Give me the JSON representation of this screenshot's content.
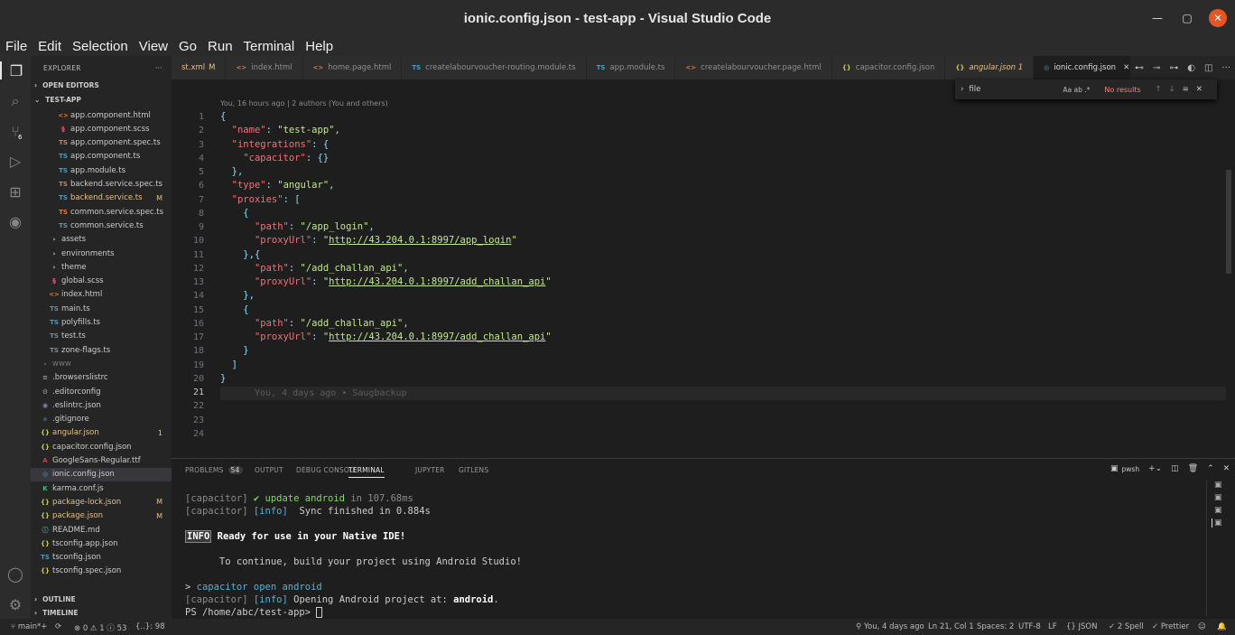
{
  "window": {
    "title": "ionic.config.json - test-app - Visual Studio Code"
  },
  "menu": [
    "File",
    "Edit",
    "Selection",
    "View",
    "Go",
    "Run",
    "Terminal",
    "Help"
  ],
  "activity_badge": "6",
  "explorer": {
    "header": "EXPLORER",
    "open_editors": "OPEN EDITORS",
    "project": "TEST-APP",
    "outline": "OUTLINE",
    "timeline": "TIMELINE",
    "files": [
      {
        "name": "app.component.html",
        "icon": "<>",
        "color": "#e37933",
        "indent": 1
      },
      {
        "name": "app.component.scss",
        "icon": "§",
        "color": "#f55385",
        "indent": 1
      },
      {
        "name": "app.component.spec.ts",
        "icon": "TS",
        "color": "#e37933",
        "indent": 1
      },
      {
        "name": "app.component.ts",
        "icon": "TS",
        "color": "#519aba",
        "indent": 1
      },
      {
        "name": "app.module.ts",
        "icon": "TS",
        "color": "#519aba",
        "indent": 1
      },
      {
        "name": "backend.service.spec.ts",
        "icon": "TS",
        "color": "#e37933",
        "indent": 1
      },
      {
        "name": "backend.service.ts",
        "icon": "TS",
        "color": "#519aba",
        "indent": 1,
        "status": "M",
        "modified": true
      },
      {
        "name": "common.service.spec.ts",
        "icon": "TS",
        "color": "#e37933",
        "indent": 1
      },
      {
        "name": "common.service.ts",
        "icon": "TS",
        "color": "#519aba",
        "indent": 1
      },
      {
        "name": "assets",
        "icon": "›",
        "color": "#ccc",
        "indent": 0.5
      },
      {
        "name": "environments",
        "icon": "›",
        "color": "#ccc",
        "indent": 0.5
      },
      {
        "name": "theme",
        "icon": "›",
        "color": "#ccc",
        "indent": 0.5
      },
      {
        "name": "global.scss",
        "icon": "§",
        "color": "#f55385",
        "indent": 0.5
      },
      {
        "name": "index.html",
        "icon": "<>",
        "color": "#e37933",
        "indent": 0.5
      },
      {
        "name": "main.ts",
        "icon": "TS",
        "color": "#519aba",
        "indent": 0.5
      },
      {
        "name": "polyfills.ts",
        "icon": "TS",
        "color": "#519aba",
        "indent": 0.5
      },
      {
        "name": "test.ts",
        "icon": "TS",
        "color": "#519aba",
        "indent": 0.5
      },
      {
        "name": "zone-flags.ts",
        "icon": "TS",
        "color": "#519aba",
        "indent": 0.5
      },
      {
        "name": "www",
        "icon": "›",
        "color": "#777",
        "indent": 0,
        "dim": true
      },
      {
        "name": ".browserslistrc",
        "icon": "≡",
        "color": "#999",
        "indent": 0
      },
      {
        "name": ".editorconfig",
        "icon": "⚙",
        "color": "#999",
        "indent": 0
      },
      {
        "name": ".eslintrc.json",
        "icon": "◉",
        "color": "#a074c4",
        "indent": 0
      },
      {
        "name": ".gitignore",
        "icon": "◆",
        "color": "#41535b",
        "indent": 0
      },
      {
        "name": "angular.json",
        "icon": "{}",
        "color": "#cbcb41",
        "indent": 0,
        "status": "1",
        "modified": true
      },
      {
        "name": "capacitor.config.json",
        "icon": "{}",
        "color": "#cbcb41",
        "indent": 0
      },
      {
        "name": "GoogleSans-Regular.ttf",
        "icon": "A",
        "color": "#cc3e44",
        "indent": 0
      },
      {
        "name": "ionic.config.json",
        "icon": "◎",
        "color": "#519aba",
        "indent": 0,
        "selected": true
      },
      {
        "name": "karma.conf.js",
        "icon": "K",
        "color": "#41b883",
        "indent": 0
      },
      {
        "name": "package-lock.json",
        "icon": "{}",
        "color": "#cbcb41",
        "indent": 0,
        "status": "M",
        "modified": true
      },
      {
        "name": "package.json",
        "icon": "{}",
        "color": "#cbcb41",
        "indent": 0,
        "status": "M",
        "modified": true
      },
      {
        "name": "README.md",
        "icon": "ⓘ",
        "color": "#519aba",
        "indent": 0
      },
      {
        "name": "tsconfig.app.json",
        "icon": "{}",
        "color": "#cbcb41",
        "indent": 0
      },
      {
        "name": "tsconfig.json",
        "icon": "TS",
        "color": "#519aba",
        "indent": 0
      },
      {
        "name": "tsconfig.spec.json",
        "icon": "{}",
        "color": "#cbcb41",
        "indent": 0
      }
    ]
  },
  "tabs": [
    {
      "label": "st.xml",
      "extra": "M",
      "icon": "",
      "color": "#e2c08d"
    },
    {
      "label": "index.html",
      "icon": "<>",
      "color": "#e37933"
    },
    {
      "label": "home.page.html",
      "icon": "<>",
      "color": "#e37933"
    },
    {
      "label": "createlabourvoucher-routing.module.ts",
      "icon": "TS",
      "color": "#519aba"
    },
    {
      "label": "app.module.ts",
      "icon": "TS",
      "color": "#519aba"
    },
    {
      "label": "createlabourvoucher.page.html",
      "icon": "<>",
      "color": "#e37933"
    },
    {
      "label": "capacitor.config.json",
      "icon": "{}",
      "color": "#cbcb41"
    },
    {
      "label": "angular.json 1",
      "icon": "{}",
      "color": "#cbcb41",
      "italic": true,
      "modified": true
    },
    {
      "label": "ionic.config.json",
      "icon": "◎",
      "color": "#519aba",
      "active": true,
      "close": "✕"
    }
  ],
  "editor": {
    "blame": "You, 16 hours ago | 2 authors (You and others)",
    "inline_blame": "You, 4 days ago • Saugbackup",
    "lines": [
      "{",
      "  \"name\": \"test-app\",",
      "  \"integrations\": {",
      "    \"capacitor\": {}",
      "  },",
      "  \"type\": \"angular\",",
      "  \"proxies\": [",
      "    {",
      "      \"path\": \"/app_login\",",
      "      \"proxyUrl\": \"http://43.204.0.1:8997/app_login\"",
      "    },{",
      "      \"path\": \"/add_challan_api\",",
      "      \"proxyUrl\": \"http://43.204.0.1:8997/add_challan_api\"",
      "    },",
      "    {",
      "      \"path\": \"/add_challan_api\",",
      "      \"proxyUrl\": \"http://43.204.0.1:8997/add_challan_api\"",
      "    }",
      "  ]",
      "}",
      "",
      "",
      "",
      ""
    ],
    "current_line": 21
  },
  "find": {
    "value": "file",
    "options": "Aa  ab  .*",
    "result": "No results"
  },
  "panel": {
    "tabs": [
      {
        "label": "PROBLEMS",
        "badge": "54"
      },
      {
        "label": "OUTPUT"
      },
      {
        "label": "DEBUG CONSOLE"
      },
      {
        "label": "TERMINAL",
        "active": true
      },
      {
        "label": "JUPYTER"
      },
      {
        "label": "GITLENS"
      }
    ],
    "shell": "pwsh",
    "terminal": [
      {
        "parts": [
          [
            "tg",
            "[capacitor] "
          ],
          [
            "tgreen",
            "✔ update android"
          ],
          [
            "tg",
            " in 107.68ms"
          ]
        ]
      },
      {
        "parts": [
          [
            "tg",
            "[capacitor] "
          ],
          [
            "tc",
            "[info]"
          ],
          [
            "",
            "  Sync finished in 0.884s"
          ]
        ]
      },
      {
        "parts": []
      },
      {
        "parts": [
          [
            "info",
            "INFO"
          ],
          [
            "b",
            " Ready for use in your Native IDE!"
          ]
        ]
      },
      {
        "parts": []
      },
      {
        "parts": [
          [
            "",
            "      To continue, build your project using Android Studio!"
          ]
        ]
      },
      {
        "parts": []
      },
      {
        "parts": [
          [
            "",
            "> "
          ],
          [
            "tc",
            "capacitor open android"
          ]
        ]
      },
      {
        "parts": [
          [
            "tg",
            "[capacitor] "
          ],
          [
            "tc",
            "[info]"
          ],
          [
            "",
            " Opening Android project at: "
          ],
          [
            "b",
            "android"
          ],
          [
            "",
            "."
          ]
        ]
      },
      {
        "parts": [
          [
            "",
            "PS /home/abc/test-app> "
          ],
          [
            "cursor",
            ""
          ]
        ]
      }
    ]
  },
  "status": {
    "branch": "main*+",
    "problems": "⊗ 0 ⚠ 1 ⓘ 53",
    "braces": "{..}: 98",
    "blame": "You, 4 days ago",
    "position": "Ln 21, Col 1",
    "spaces": "Spaces: 2",
    "encoding": "UTF-8",
    "eol": "LF",
    "language": "{} JSON",
    "spell": "✓ 2 Spell",
    "prettier": "✓ Prettier"
  }
}
